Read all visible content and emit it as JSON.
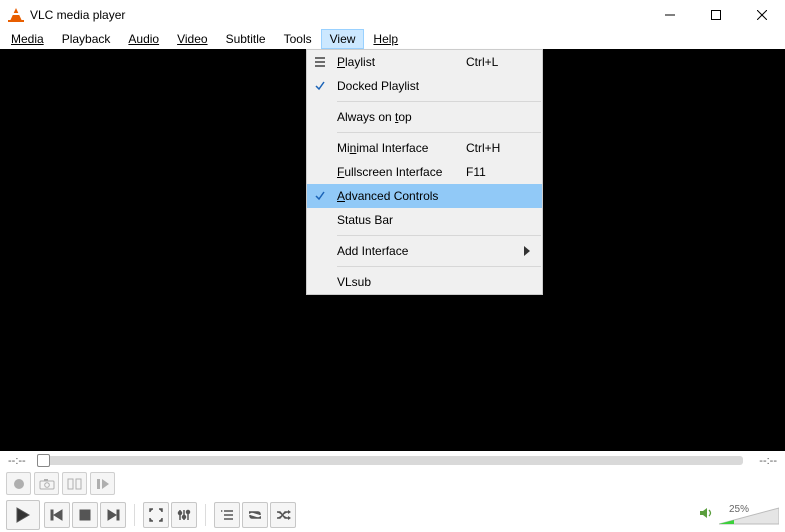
{
  "title": "VLC media player",
  "menubar": {
    "media": "Media",
    "playback": "Playback",
    "audio": "Audio",
    "video": "Video",
    "subtitle": "Subtitle",
    "tools": "Tools",
    "view": "View",
    "help": "Help"
  },
  "view_menu": {
    "playlist": {
      "label": "Playlist",
      "accel": "Ctrl+L"
    },
    "docked_playlist": {
      "label": "Docked Playlist"
    },
    "always_on_top": {
      "label": "Always on top"
    },
    "minimal_interface": {
      "label": "Minimal Interface",
      "accel": "Ctrl+H"
    },
    "fullscreen_interface": {
      "label": "Fullscreen Interface",
      "accel": "F11"
    },
    "advanced_controls": {
      "label": "Advanced Controls"
    },
    "status_bar": {
      "label": "Status Bar"
    },
    "add_interface": {
      "label": "Add Interface"
    },
    "vlsub": {
      "label": "VLsub"
    }
  },
  "seek": {
    "elapsed": "--:--",
    "total": "--:--"
  },
  "volume": {
    "percent_label": "25%",
    "percent": 25
  }
}
